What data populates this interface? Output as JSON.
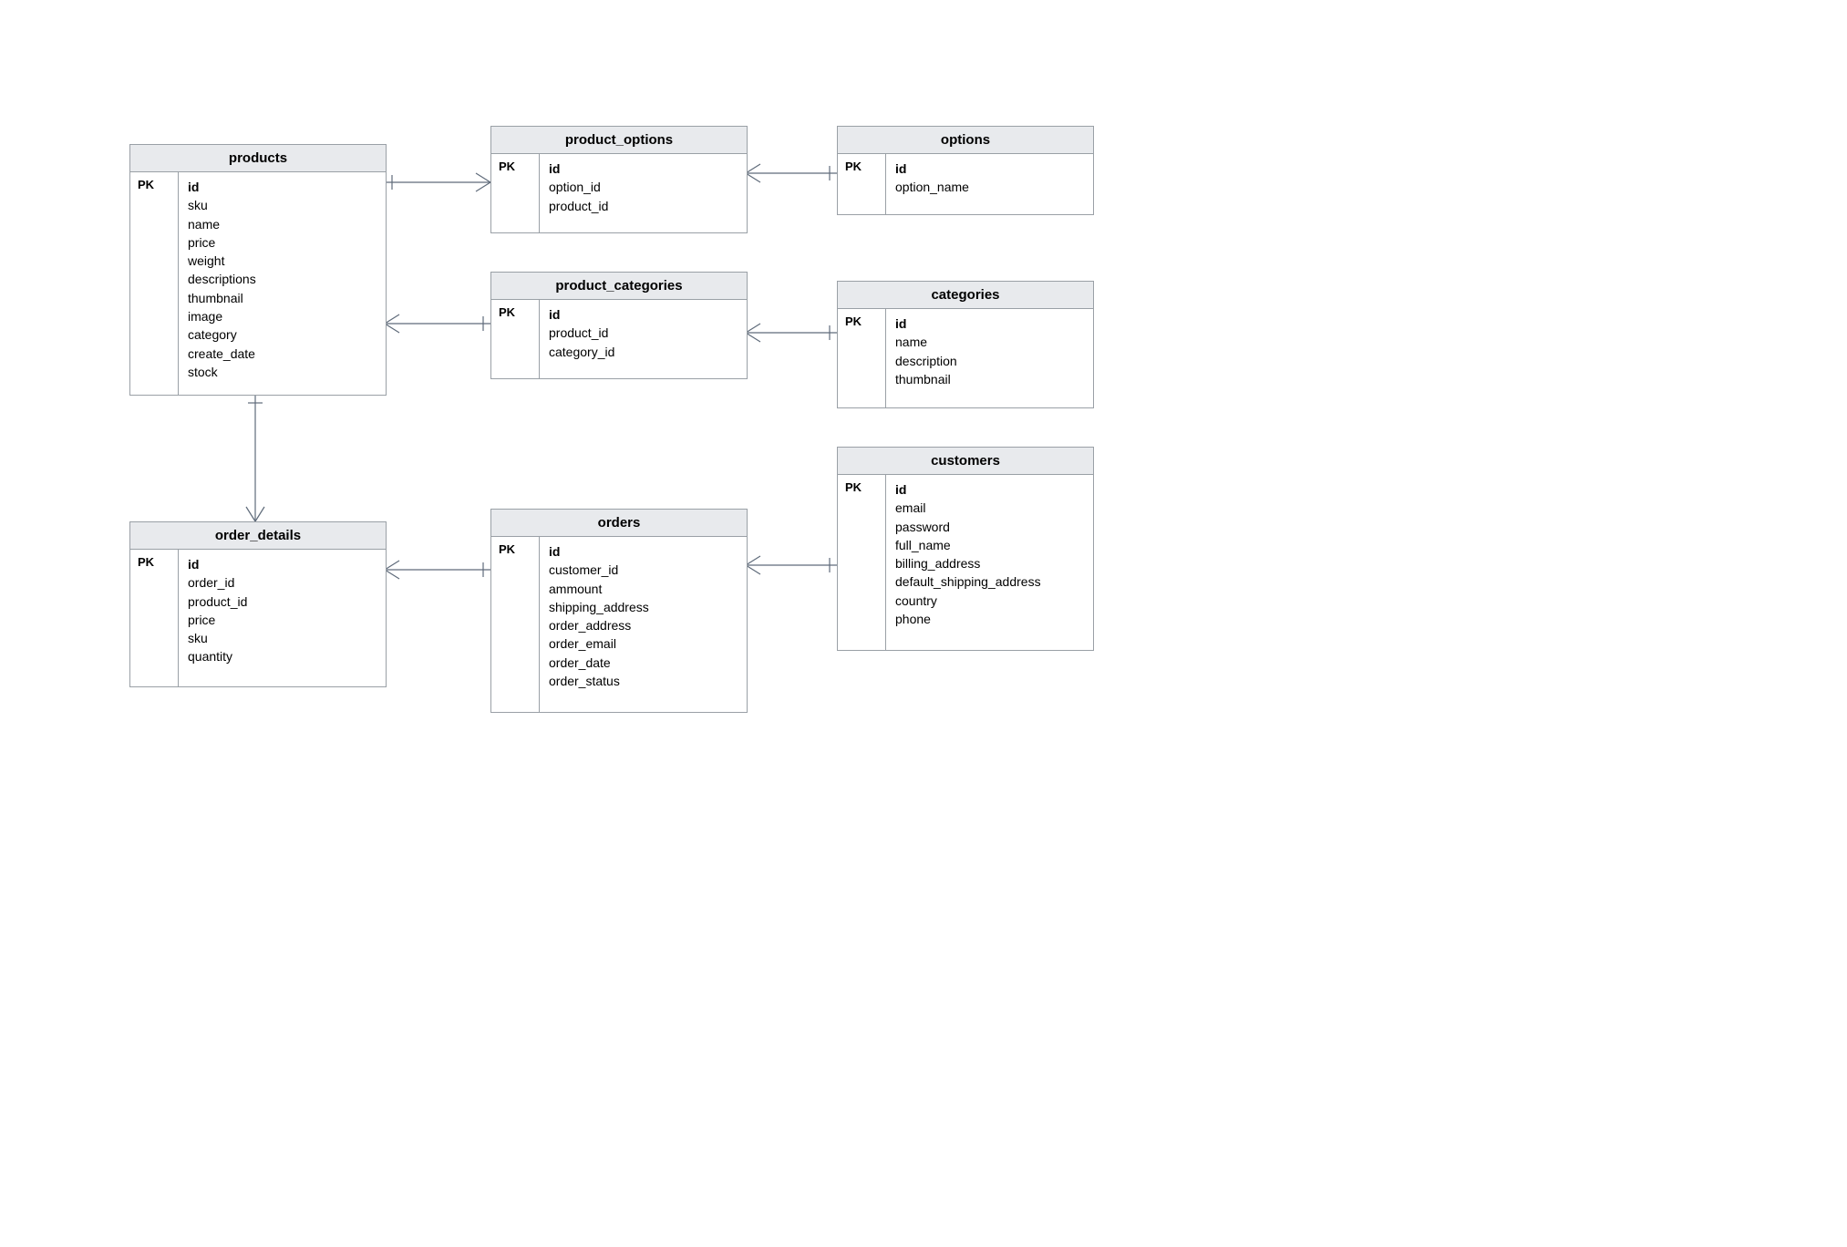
{
  "pk_label": "PK",
  "entities": {
    "products": {
      "title": "products",
      "fields": [
        "id",
        "sku",
        "name",
        "price",
        "weight",
        "descriptions",
        "thumbnail",
        "image",
        "category",
        "create_date",
        "stock"
      ]
    },
    "product_options": {
      "title": "product_options",
      "fields": [
        "id",
        "option_id",
        "product_id"
      ]
    },
    "options": {
      "title": "options",
      "fields": [
        "id",
        "option_name"
      ]
    },
    "product_categories": {
      "title": "product_categories",
      "fields": [
        "id",
        "product_id",
        "category_id"
      ]
    },
    "categories": {
      "title": "categories",
      "fields": [
        "id",
        "name",
        "description",
        "thumbnail"
      ]
    },
    "order_details": {
      "title": "order_details",
      "fields": [
        "id",
        "order_id",
        "product_id",
        "price",
        "sku",
        "quantity"
      ]
    },
    "orders": {
      "title": "orders",
      "fields": [
        "id",
        "customer_id",
        "ammount",
        "shipping_address",
        "order_address",
        "order_email",
        "order_date",
        "order_status"
      ]
    },
    "customers": {
      "title": "customers",
      "fields": [
        "id",
        "email",
        "password",
        "full_name",
        "billing_address",
        "default_shipping_address",
        "country",
        "phone"
      ]
    }
  },
  "relationships": [
    {
      "from": "products",
      "to": "product_options",
      "type": "one-to-many"
    },
    {
      "from": "options",
      "to": "product_options",
      "type": "one-to-many"
    },
    {
      "from": "products",
      "to": "product_categories",
      "type": "many-to-one-side"
    },
    {
      "from": "categories",
      "to": "product_categories",
      "type": "one-to-many"
    },
    {
      "from": "products",
      "to": "order_details",
      "type": "one-to-many"
    },
    {
      "from": "orders",
      "to": "order_details",
      "type": "one-to-many"
    },
    {
      "from": "customers",
      "to": "orders",
      "type": "one-to-many"
    }
  ]
}
